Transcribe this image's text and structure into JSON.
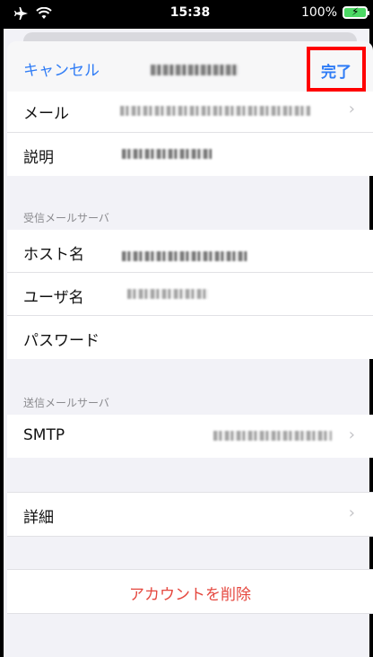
{
  "status_bar": {
    "time": "15:38",
    "battery": "100%"
  },
  "nav": {
    "cancel_label": "キャンセル",
    "done_label": "完了"
  },
  "account_rows": [
    {
      "label": "メール"
    },
    {
      "label": "説明"
    }
  ],
  "incoming": {
    "header": "受信メールサーバ",
    "rows": [
      {
        "label": "ホスト名"
      },
      {
        "label": "ユーザ名"
      },
      {
        "label": "パスワード"
      }
    ]
  },
  "outgoing": {
    "header": "送信メールサーバ",
    "rows": [
      {
        "label": "SMTP"
      }
    ]
  },
  "advanced": {
    "label": "詳細"
  },
  "delete_label": "アカウントを削除",
  "colors": {
    "accent": "#2f7cf6",
    "destructive": "#e5473e",
    "highlight": "#ff0000"
  }
}
